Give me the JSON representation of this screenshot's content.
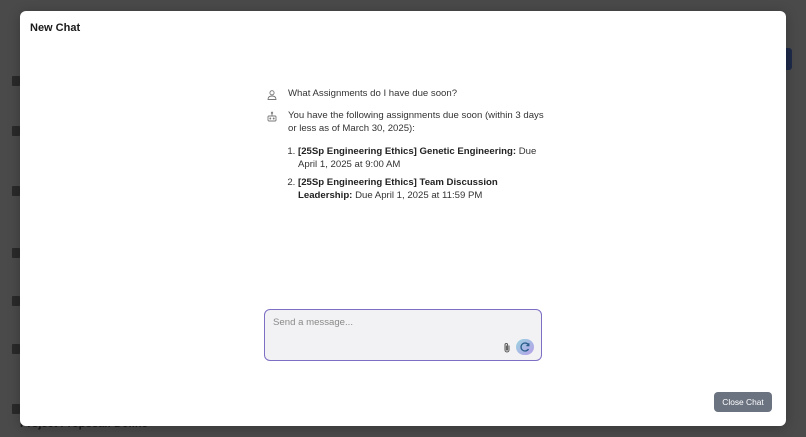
{
  "modal": {
    "title": "New Chat",
    "close_button": "Close Chat"
  },
  "background": {
    "partial_bottom_text": "Project Proposal: Define"
  },
  "chat": {
    "user_message": {
      "icon": "user-icon",
      "text": "What Assignments do I have due soon?"
    },
    "assistant_message": {
      "icon": "assistant-icon",
      "intro": "You have the following assignments due soon (within 3 days or less as of March 30, 2025):",
      "items": [
        {
          "title": "[25Sp Engineering Ethics] Genetic Engineering:",
          "due": "Due April 1, 2025 at 9:00 AM"
        },
        {
          "title": "[25Sp Engineering Ethics] Team Discussion Leadership:",
          "due": "Due April 1, 2025 at 11:59 PM"
        }
      ]
    }
  },
  "composer": {
    "placeholder": "Send a message...",
    "value": "",
    "attach_icon": "paperclip-icon",
    "send_icon": "send-icon",
    "accent_color": "#7c6fc4"
  },
  "colors": {
    "close_button_bg": "#6b7280",
    "overlay": "#4a4a4a"
  }
}
